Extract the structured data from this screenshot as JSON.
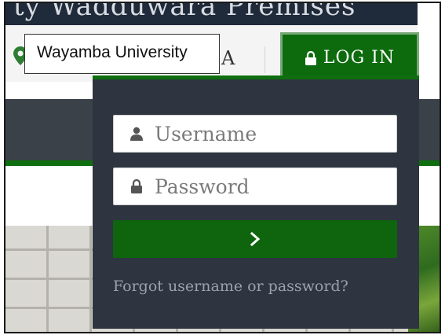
{
  "header": {
    "banner_text": "ty Wadduwara Premises"
  },
  "tooltip": {
    "text": "Wayamba University"
  },
  "utility": {
    "font_size_label": "A"
  },
  "login_button": {
    "label": "LOG IN",
    "icon": "lock-icon"
  },
  "login_panel": {
    "username": {
      "placeholder": "Username",
      "value": "",
      "icon": "user-icon"
    },
    "password": {
      "placeholder": "Password",
      "value": "",
      "icon": "lock-icon"
    },
    "submit": {
      "icon": "chevron-right-icon"
    },
    "forgot_text": "Forgot username or password?"
  },
  "colors": {
    "brand_green": "#0e650e",
    "panel_bg": "#2e3440",
    "nav_bg": "#3b4149"
  }
}
